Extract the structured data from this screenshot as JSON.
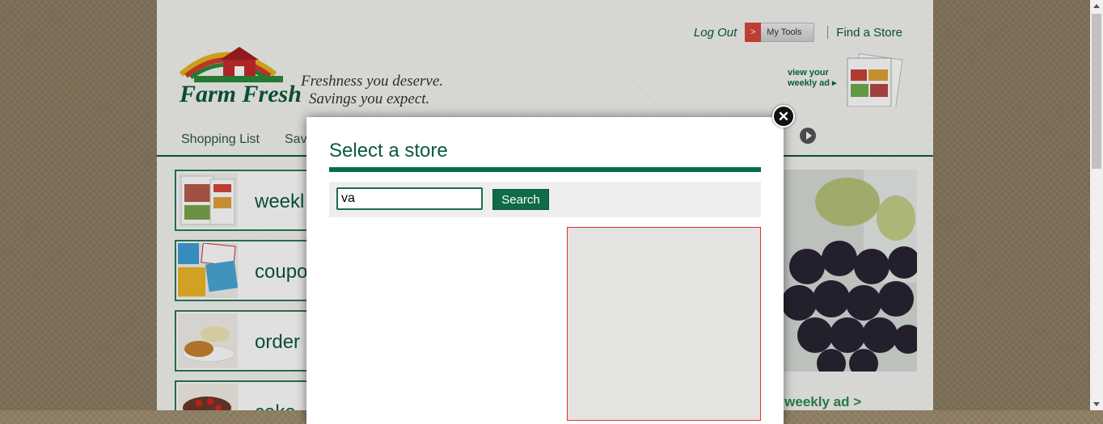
{
  "header": {
    "logo_text": "Farm Fresh",
    "tagline": "Freshness you deserve. Savings you expect.",
    "logout_label": "Log Out",
    "my_tools_label": "My Tools",
    "find_store_label": "Find a Store",
    "weekly_ad_promo": "view your weekly ad ▸"
  },
  "nav": {
    "items": [
      {
        "label": "Shopping List"
      },
      {
        "label": "Sav"
      }
    ]
  },
  "tiles": [
    {
      "label": "weekl",
      "icon": "weekly-ad-flyer"
    },
    {
      "label": "coupo",
      "icon": "coupons"
    },
    {
      "label": "order",
      "icon": "bakery-order"
    },
    {
      "label": "cake",
      "icon": "cake"
    }
  ],
  "hero": {
    "link_text": "e weekly ad  >"
  },
  "modal": {
    "title": "Select a store",
    "search": {
      "value": "va",
      "button_label": "Search"
    },
    "close_icon": "close-icon"
  },
  "colors": {
    "brand_green": "#0a5a3a",
    "button_green": "#0d6b45",
    "map_border": "#dd3333",
    "tools_red": "#d9463c"
  }
}
